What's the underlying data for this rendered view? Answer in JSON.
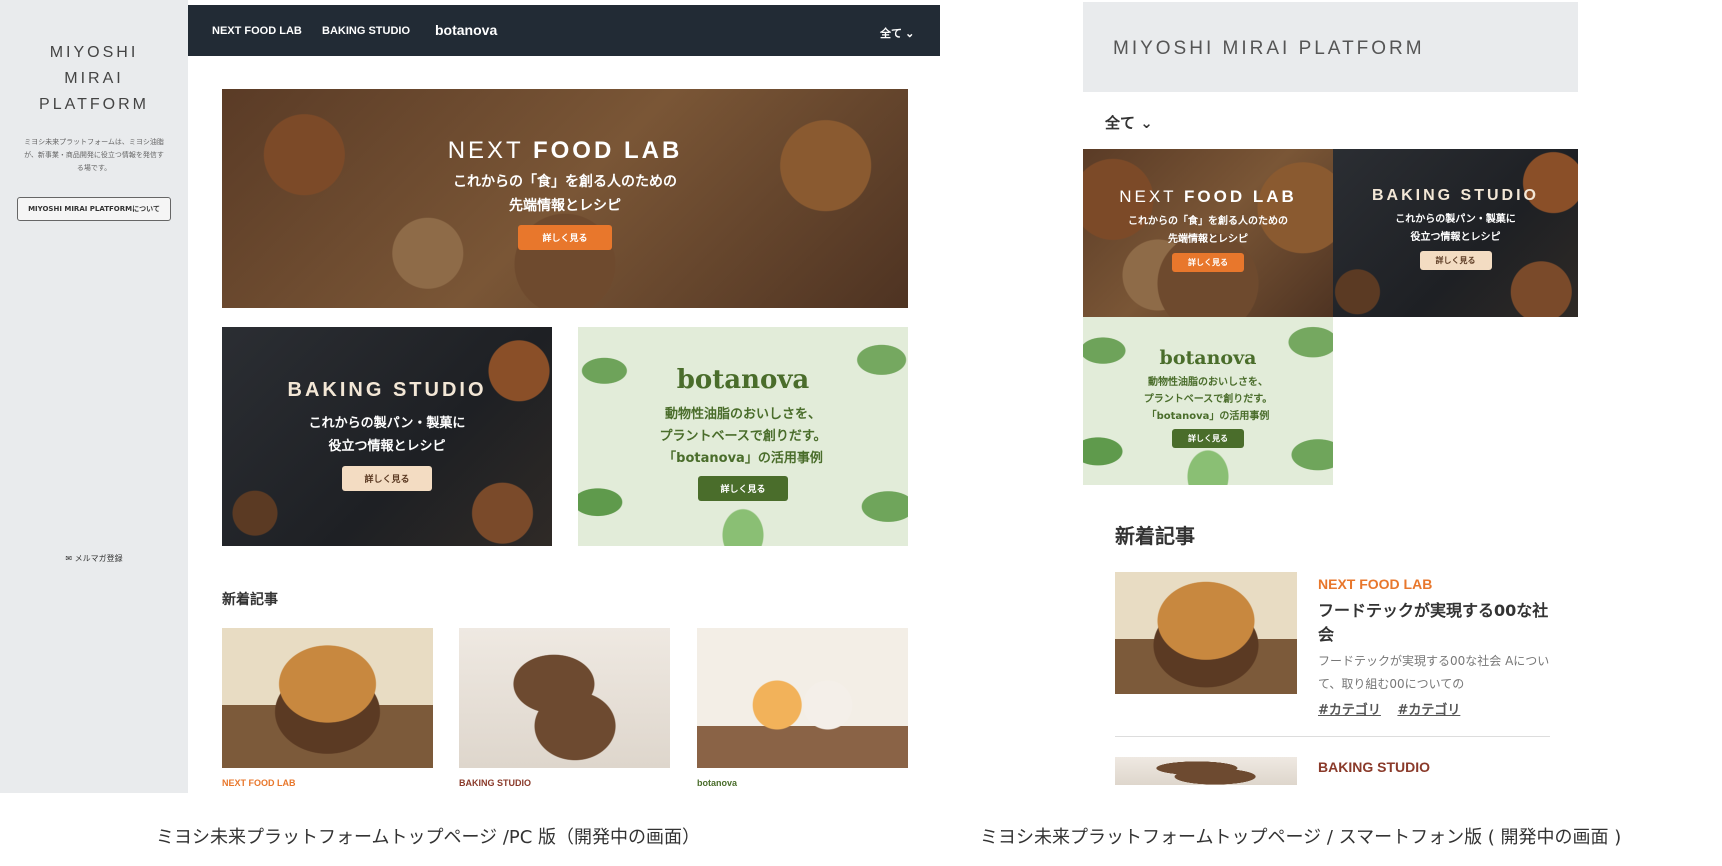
{
  "pc": {
    "sidebar": {
      "brand": "MIYOSHI\nMIRAI\nPLATFORM",
      "description": "ミヨシ未来プラットフォームは、ミヨシ油脂が、新事業・商品開発に役立つ情報を発信する場です。",
      "about_button": "MIYOSHI MIRAI PLATFORMについて",
      "newsletter": "メルマガ登録"
    },
    "nav": {
      "items": [
        "NEXT FOOD LAB",
        "BAKING STUDIO",
        "botanova"
      ],
      "filter": "全て"
    },
    "banners": {
      "food": {
        "title_light": "NEXT ",
        "title_bold": "FOOD LAB",
        "line1": "これからの「食」を創る人のための",
        "line2": "先端情報とレシピ",
        "button": "詳しく見る"
      },
      "baking": {
        "title": "BAKING STUDIO",
        "line1": "これからの製パン・製菓に",
        "line2": "役立つ情報とレシピ",
        "button": "詳しく見る"
      },
      "botanova": {
        "title": "botanova",
        "line1": "動物性油脂のおいしさを、",
        "line2": "プラントベースで創りだす。",
        "line3": "「botanova」の活用事例",
        "button": "詳しく見る"
      }
    },
    "news": {
      "heading": "新着記事",
      "categories": [
        "NEXT FOOD LAB",
        "BAKING STUDIO",
        "botanova"
      ]
    }
  },
  "phone": {
    "header": "MIYOSHI MIRAI PLATFORM",
    "filter": "全て",
    "banners": {
      "food": {
        "title_light": "NEXT ",
        "title_bold": "FOOD LAB",
        "line1": "これからの「食」を創る人のための",
        "line2": "先端情報とレシピ",
        "button": "詳しく見る"
      },
      "baking": {
        "title": "BAKING STUDIO",
        "line1": "これからの製パン・製菓に",
        "line2": "役立つ情報とレシピ",
        "button": "詳しく見る"
      },
      "botanova": {
        "title": "botanova",
        "line1": "動物性油脂のおいしさを、",
        "line2": "プラントベースで創りだす。",
        "line3": "「botanova」の活用事例",
        "button": "詳しく見る"
      }
    },
    "news": {
      "heading": "新着記事",
      "article1": {
        "category": "NEXT FOOD LAB",
        "title": "フードテックが実現する00な社会",
        "excerpt": "フードテックが実現する00な社会 Aについて、取り組む00についての",
        "tags": [
          "#カテゴリ",
          "#カテゴリ"
        ]
      },
      "article2": {
        "category": "BAKING STUDIO"
      }
    }
  },
  "captions": {
    "pc": "ミヨシ未来プラットフォームトップページ /PC 版（開発中の画面）",
    "phone": "ミヨシ未来プラットフォームトップページ / スマートフォン版 ( 開発中の画面 )"
  },
  "colors": {
    "accent_orange": "#e8772c",
    "nav_dark": "#222b35",
    "botanova_green": "#4a6d2b",
    "sidebar_gray": "#e9ebed"
  }
}
